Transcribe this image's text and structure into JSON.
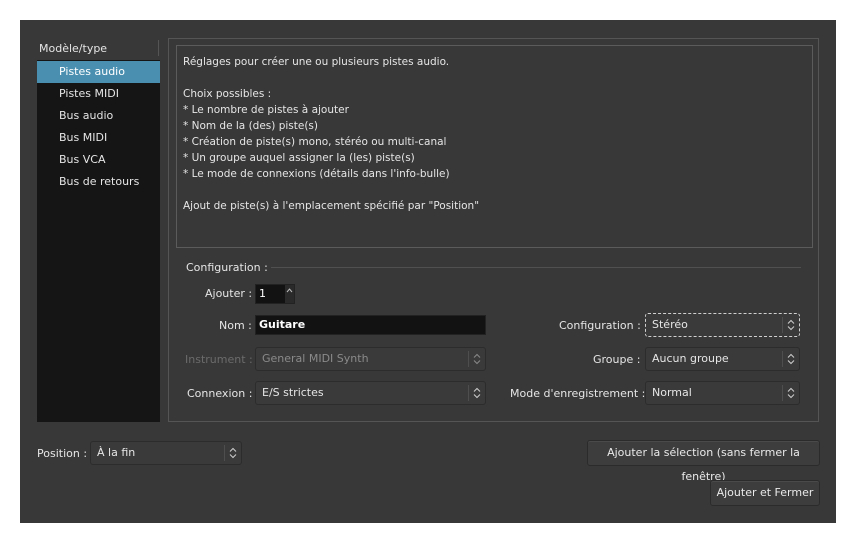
{
  "type_list": {
    "header": "Modèle/type",
    "items": [
      "Pistes audio",
      "Pistes MIDI",
      "Bus audio",
      "Bus MIDI",
      "Bus VCA",
      "Bus de retours"
    ],
    "selected_index": 0
  },
  "description": {
    "lines": [
      "Réglages pour créer une ou plusieurs pistes audio.",
      "",
      "Choix possibles :",
      "* Le nombre de pistes à ajouter",
      "* Nom de la (des) piste(s)",
      "* Création de piste(s) mono, stéréo ou multi-canal",
      "* Un groupe auquel assigner la (les) piste(s)",
      "* Le mode de connexions (détails dans l'info-bulle)",
      "",
      "Ajout de piste(s) à l'emplacement spécifié par \"Position\""
    ]
  },
  "config": {
    "section_label": "Configuration :",
    "add_label": "Ajouter :",
    "add_value": "1",
    "name_label": "Nom :",
    "name_value": "Guitare",
    "instrument_label": "Instrument :",
    "instrument_value": "General MIDI Synth",
    "connection_label": "Connexion :",
    "connection_value": "E/S strictes",
    "configuration_label": "Configuration :",
    "configuration_value": "Stéréo",
    "group_label": "Groupe :",
    "group_value": "Aucun groupe",
    "record_mode_label": "Mode d'enregistrement :",
    "record_mode_value": "Normal"
  },
  "footer": {
    "position_label": "Position :",
    "position_value": "À la fin",
    "add_selection_label": "Ajouter la sélection (sans fermer la fenêtre)",
    "add_close_label": "Ajouter et Fermer"
  },
  "colors": {
    "background": "#383838",
    "list_background": "#151515",
    "selection": "#4a8fb0"
  }
}
